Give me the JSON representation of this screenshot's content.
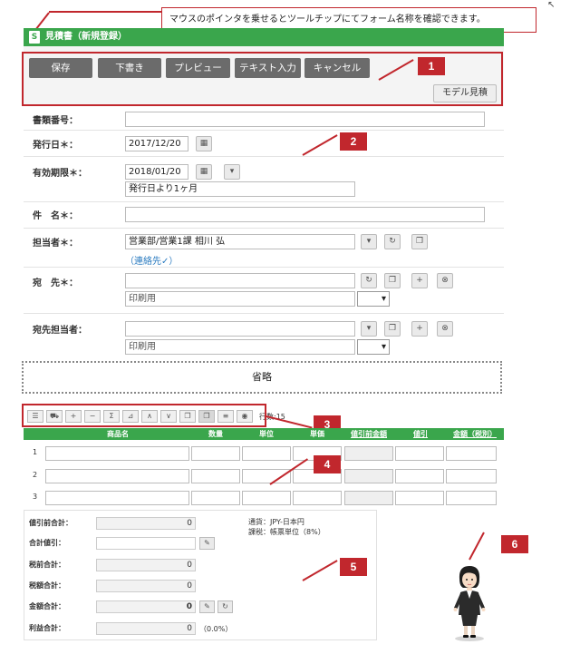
{
  "callout_text": "マウスのポインタを乗せるとツールチップにてフォーム名称を確認できます。",
  "window_title": "見積書（新規登録）",
  "title_icon": "S",
  "toolbar": {
    "save": "保存",
    "draft": "下書き",
    "preview": "プレビュー",
    "text_input": "テキスト入力",
    "cancel": "キャンセル",
    "model": "モデル見積"
  },
  "markers": [
    "1",
    "2",
    "3",
    "4",
    "5",
    "6"
  ],
  "form": {
    "doc_no_label": "書類番号：",
    "issue_date_label": "発行日＊：",
    "issue_date": "2017/12/20",
    "expiry_label": "有効期限＊：",
    "expiry_date": "2018/01/20",
    "expiry_note": "発行日より1ヶ月",
    "subject_label": "件　名＊：",
    "owner_label": "担当者＊：",
    "owner_value": "営業部/営業1課 相川 弘",
    "contact_link": "（連絡先✓）",
    "to_label": "宛　先＊：",
    "to_print_ph": "印刷用",
    "to_person_label": "宛先担当者：",
    "to_person_print_ph": "印刷用"
  },
  "omitted": "省略",
  "items": {
    "row_count_text": "行数:15",
    "headers": [
      "商品名",
      "数量",
      "単位",
      "単価",
      "値引前金額",
      "値引",
      "金額（税別）"
    ],
    "rows": [
      "1",
      "2",
      "3"
    ]
  },
  "summary": {
    "pre_discount_label": "値引前合計：",
    "pre_discount_value": "0",
    "discount_label": "合計値引：",
    "pretax_label": "税前合計：",
    "pretax_value": "0",
    "tax_label": "税額合計：",
    "tax_value": "0",
    "amount_label": "金額合計：",
    "amount_value": "0",
    "profit_label": "利益合計：",
    "profit_value": "0",
    "profit_pct": "（0.0%）",
    "currency_note": "通貨：JPY-日本円",
    "tax_note": "課税：帳票単位（8%）"
  },
  "colors": {
    "accent_green": "#3aa64c",
    "callout_red": "#c1272d",
    "button_gray": "#6b6b6b"
  },
  "icons": [
    "calendar-icon",
    "chevron-down-icon",
    "refresh-icon",
    "copy-icon",
    "plus-icon",
    "clear-icon",
    "edit-icon",
    "eye-icon"
  ]
}
